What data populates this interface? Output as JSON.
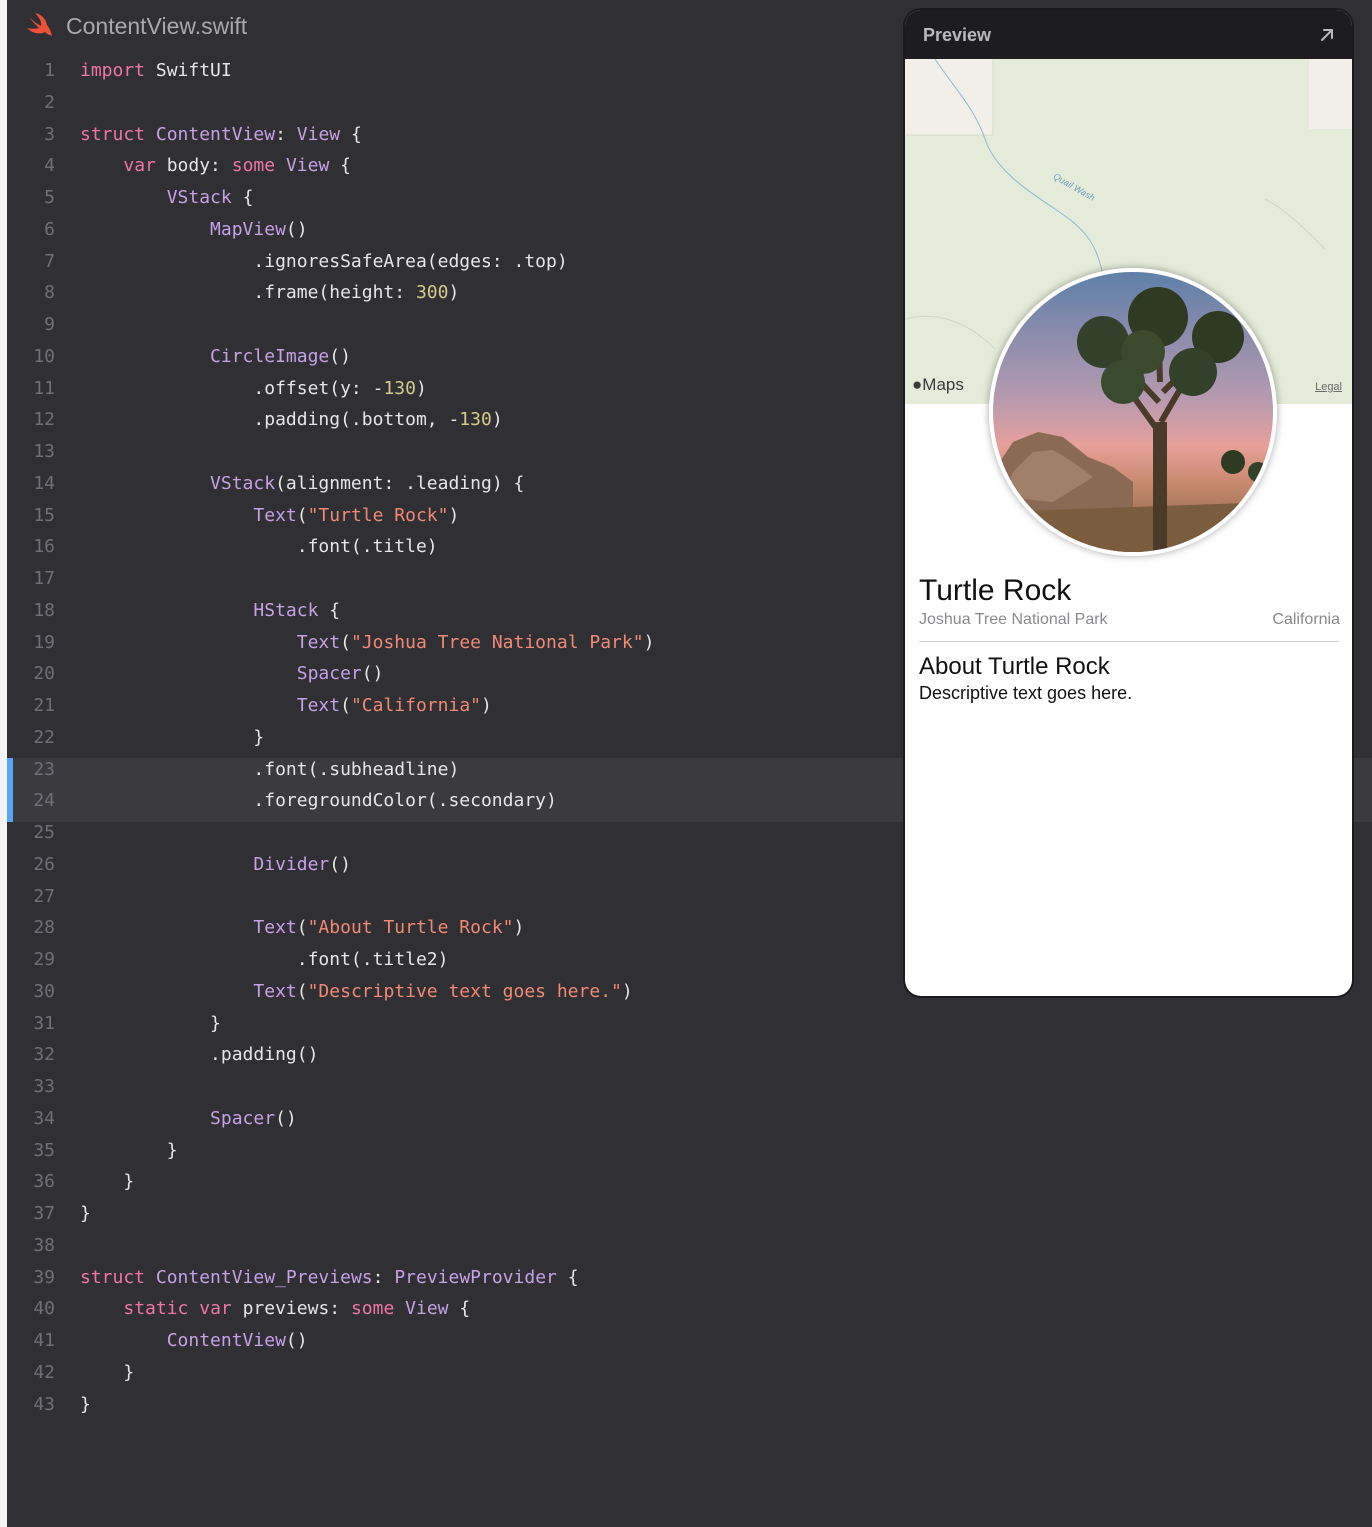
{
  "file": {
    "name": "ContentView.swift",
    "icon": "swift-icon"
  },
  "preview": {
    "title": "Preview",
    "expand_icon": "arrow-up-right-icon",
    "maps_label": "Maps",
    "legal_label": "Legal",
    "wash_label": "Quail Wash",
    "landmark": {
      "title": "Turtle Rock",
      "park": "Joshua Tree National Park",
      "state": "California",
      "about_title": "About Turtle Rock",
      "description": "Descriptive text goes here."
    }
  },
  "colors": {
    "editor_bg": "#303034",
    "highlight_line_bg": "#3a3a3f",
    "highlight_marker": "#5aa6f5",
    "keyword": "#ee76a6",
    "type": "#c7a0e6",
    "number": "#d8c98a",
    "string": "#f08a74",
    "plain": "#e6e6e6",
    "line_number": "#6f6f76"
  },
  "highlighted_lines": [
    23,
    24
  ],
  "code_lines": [
    [
      [
        "kw",
        "import"
      ],
      [
        "p",
        " SwiftUI"
      ]
    ],
    [],
    [
      [
        "kw",
        "struct"
      ],
      [
        "p",
        " "
      ],
      [
        "ty",
        "ContentView"
      ],
      [
        "p",
        ": "
      ],
      [
        "ty",
        "View"
      ],
      [
        "p",
        " {"
      ]
    ],
    [
      [
        "p",
        "    "
      ],
      [
        "kw",
        "var"
      ],
      [
        "p",
        " body: "
      ],
      [
        "kw",
        "some"
      ],
      [
        "p",
        " "
      ],
      [
        "ty",
        "View"
      ],
      [
        "p",
        " {"
      ]
    ],
    [
      [
        "p",
        "        "
      ],
      [
        "ty",
        "VStack"
      ],
      [
        "p",
        " {"
      ]
    ],
    [
      [
        "p",
        "            "
      ],
      [
        "ty",
        "MapView"
      ],
      [
        "p",
        "()"
      ]
    ],
    [
      [
        "p",
        "                .ignoresSafeArea(edges: .top)"
      ]
    ],
    [
      [
        "p",
        "                .frame(height: "
      ],
      [
        "num",
        "300"
      ],
      [
        "p",
        ")"
      ]
    ],
    [],
    [
      [
        "p",
        "            "
      ],
      [
        "ty",
        "CircleImage"
      ],
      [
        "p",
        "()"
      ]
    ],
    [
      [
        "p",
        "                .offset(y: -"
      ],
      [
        "num",
        "130"
      ],
      [
        "p",
        ")"
      ]
    ],
    [
      [
        "p",
        "                .padding(.bottom, -"
      ],
      [
        "num",
        "130"
      ],
      [
        "p",
        ")"
      ]
    ],
    [],
    [
      [
        "p",
        "            "
      ],
      [
        "ty",
        "VStack"
      ],
      [
        "p",
        "(alignment: .leading) {"
      ]
    ],
    [
      [
        "p",
        "                "
      ],
      [
        "ty",
        "Text"
      ],
      [
        "p",
        "("
      ],
      [
        "str",
        "\"Turtle Rock\""
      ],
      [
        "p",
        ")"
      ]
    ],
    [
      [
        "p",
        "                    .font(.title)"
      ]
    ],
    [],
    [
      [
        "p",
        "                "
      ],
      [
        "ty",
        "HStack"
      ],
      [
        "p",
        " {"
      ]
    ],
    [
      [
        "p",
        "                    "
      ],
      [
        "ty",
        "Text"
      ],
      [
        "p",
        "("
      ],
      [
        "str",
        "\"Joshua Tree National Park\""
      ],
      [
        "p",
        ")"
      ]
    ],
    [
      [
        "p",
        "                    "
      ],
      [
        "ty",
        "Spacer"
      ],
      [
        "p",
        "()"
      ]
    ],
    [
      [
        "p",
        "                    "
      ],
      [
        "ty",
        "Text"
      ],
      [
        "p",
        "("
      ],
      [
        "str",
        "\"California\""
      ],
      [
        "p",
        ")"
      ]
    ],
    [
      [
        "p",
        "                }"
      ]
    ],
    [
      [
        "p",
        "                .font(.subheadline)"
      ]
    ],
    [
      [
        "p",
        "                .foregroundColor(.secondary)"
      ]
    ],
    [],
    [
      [
        "p",
        "                "
      ],
      [
        "ty",
        "Divider"
      ],
      [
        "p",
        "()"
      ]
    ],
    [],
    [
      [
        "p",
        "                "
      ],
      [
        "ty",
        "Text"
      ],
      [
        "p",
        "("
      ],
      [
        "str",
        "\"About Turtle Rock\""
      ],
      [
        "p",
        ")"
      ]
    ],
    [
      [
        "p",
        "                    .font(.title2)"
      ]
    ],
    [
      [
        "p",
        "                "
      ],
      [
        "ty",
        "Text"
      ],
      [
        "p",
        "("
      ],
      [
        "str",
        "\"Descriptive text goes here.\""
      ],
      [
        "p",
        ")"
      ]
    ],
    [
      [
        "p",
        "            }"
      ]
    ],
    [
      [
        "p",
        "            .padding()"
      ]
    ],
    [],
    [
      [
        "p",
        "            "
      ],
      [
        "ty",
        "Spacer"
      ],
      [
        "p",
        "()"
      ]
    ],
    [
      [
        "p",
        "        }"
      ]
    ],
    [
      [
        "p",
        "    }"
      ]
    ],
    [
      [
        "p",
        "}"
      ]
    ],
    [],
    [
      [
        "kw",
        "struct"
      ],
      [
        "p",
        " "
      ],
      [
        "ty",
        "ContentView_Previews"
      ],
      [
        "p",
        ": "
      ],
      [
        "ty",
        "PreviewProvider"
      ],
      [
        "p",
        " {"
      ]
    ],
    [
      [
        "p",
        "    "
      ],
      [
        "kw",
        "static"
      ],
      [
        "p",
        " "
      ],
      [
        "kw",
        "var"
      ],
      [
        "p",
        " previews: "
      ],
      [
        "kw",
        "some"
      ],
      [
        "p",
        " "
      ],
      [
        "ty",
        "View"
      ],
      [
        "p",
        " {"
      ]
    ],
    [
      [
        "p",
        "        "
      ],
      [
        "ty",
        "ContentView"
      ],
      [
        "p",
        "()"
      ]
    ],
    [
      [
        "p",
        "    }"
      ]
    ],
    [
      [
        "p",
        "}"
      ]
    ]
  ]
}
